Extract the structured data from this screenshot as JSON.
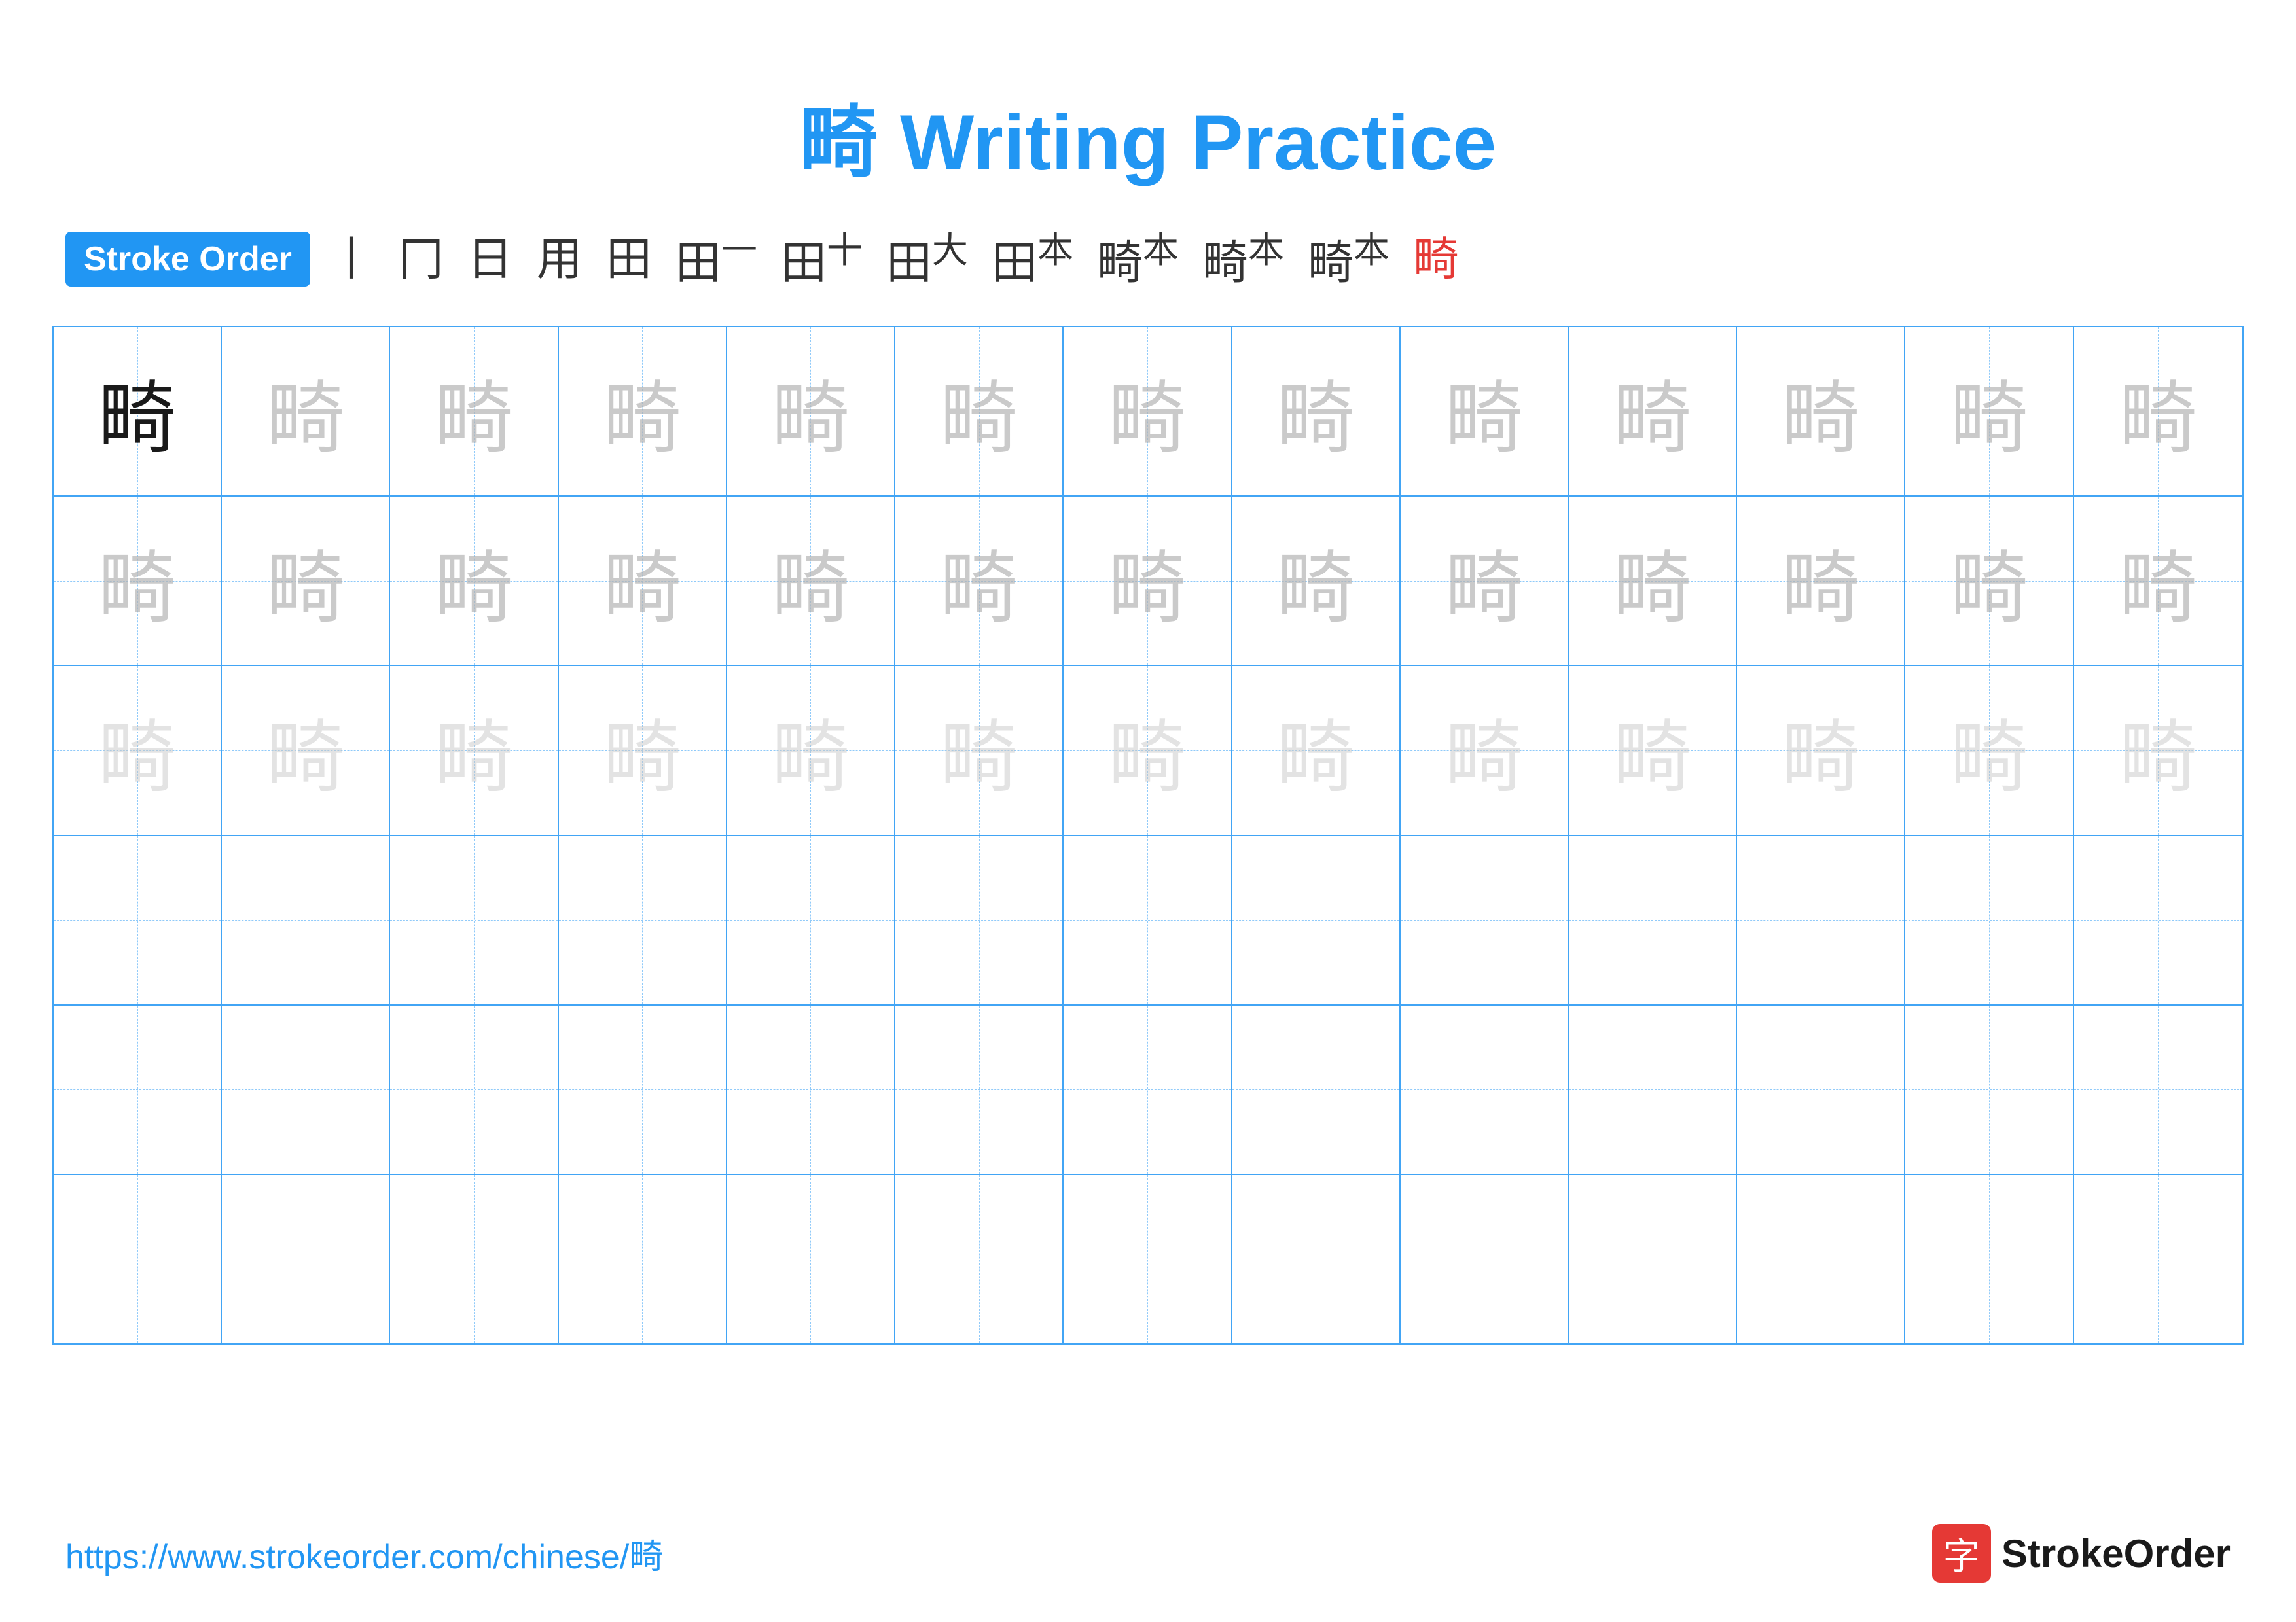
{
  "page": {
    "title": "畸 Writing Practice",
    "title_color": "#2196F3"
  },
  "stroke_order": {
    "badge_label": "Stroke Order",
    "steps": [
      "丨",
      "冂",
      "日",
      "用",
      "田",
      "田一",
      "田十",
      "田大",
      "田本",
      "畸本",
      "畸本",
      "畸本",
      "畸"
    ]
  },
  "character": "畸",
  "grid": {
    "rows": 6,
    "cols": 13,
    "row_types": [
      "solid_faded_dark",
      "faded_dark",
      "faded_light",
      "empty",
      "empty",
      "empty"
    ]
  },
  "footer": {
    "url": "https://www.strokeorder.com/chinese/畸",
    "logo_char": "字",
    "logo_name": "StrokeOrder"
  }
}
